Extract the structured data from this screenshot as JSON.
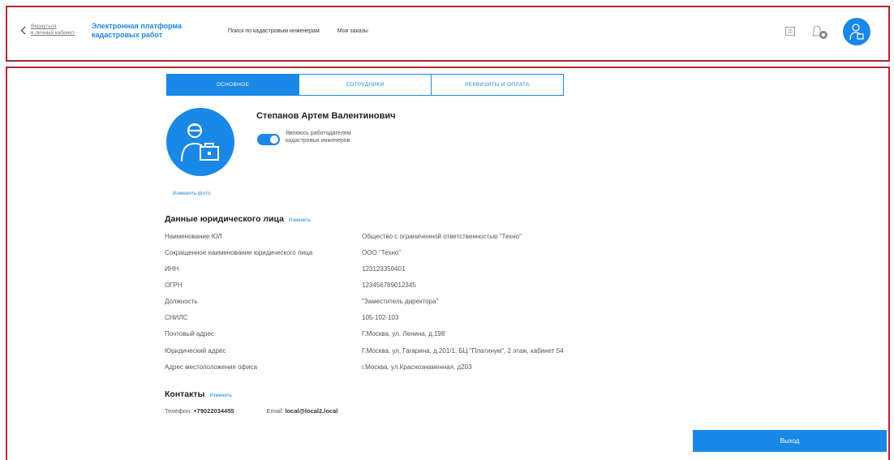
{
  "header": {
    "back_line1": "Вернуться",
    "back_line2": "в личный кабинет",
    "brand_line1": "Электронная платформа",
    "brand_line2": "кадастровых работ",
    "nav": [
      "Поиск по кадастровым инженерам",
      "Мои заказы"
    ],
    "icons": [
      "message-icon",
      "bell-icon",
      "user-avatar-icon"
    ]
  },
  "tabs": [
    {
      "label": "ОСНОВНОЕ",
      "active": true
    },
    {
      "label": "СОТРУДНИКИ",
      "active": false
    },
    {
      "label": "РЕКВИЗИТЫ И ОПЛАТА",
      "active": false
    }
  ],
  "profile": {
    "name": "Степанов Артем Валентинович",
    "toggle_label_line1": "Являюсь работодателем",
    "toggle_label_line2": "кадастровых инженеров",
    "toggle_on": true,
    "change_photo": "Изменить фото"
  },
  "legal": {
    "title": "Данные юридического лица",
    "edit": "Изменить",
    "rows": [
      {
        "label": "Наименование ЮЛ",
        "value": "Общество с ограниченной ответственностью \"Техно\""
      },
      {
        "label": "Сокращенное наименование юридического лица",
        "value": "ООО \"Техно\""
      },
      {
        "label": "ИНН",
        "value": "123123350401"
      },
      {
        "label": "ОГРН",
        "value": "123456789012345"
      },
      {
        "label": "Должность",
        "value": "\"Заместитель директора\""
      },
      {
        "label": "СНИЛС",
        "value": "105-102-103"
      },
      {
        "label": "Почтовый адрес",
        "value": "Г.Москва, ул. Ленина, д.198"
      },
      {
        "label": "Юридический адрес",
        "value": "Г.Москва, ул. Гагарина, д.201/1, БЦ \"Платинум\", 2 этаж, кабинет 54"
      },
      {
        "label": "Адрес местоположения офиса",
        "value": "г.Москва, ул.Краснознаменная, д203"
      }
    ]
  },
  "contacts": {
    "title": "Контакты",
    "edit": "Изменить",
    "phone_label": "Телефон:",
    "phone": "+79022034455",
    "email_label": "Email:",
    "email": "local@local2.local"
  },
  "exit_label": "Выход",
  "colors": {
    "accent": "#1a88e6",
    "frame": "#b3262d"
  }
}
